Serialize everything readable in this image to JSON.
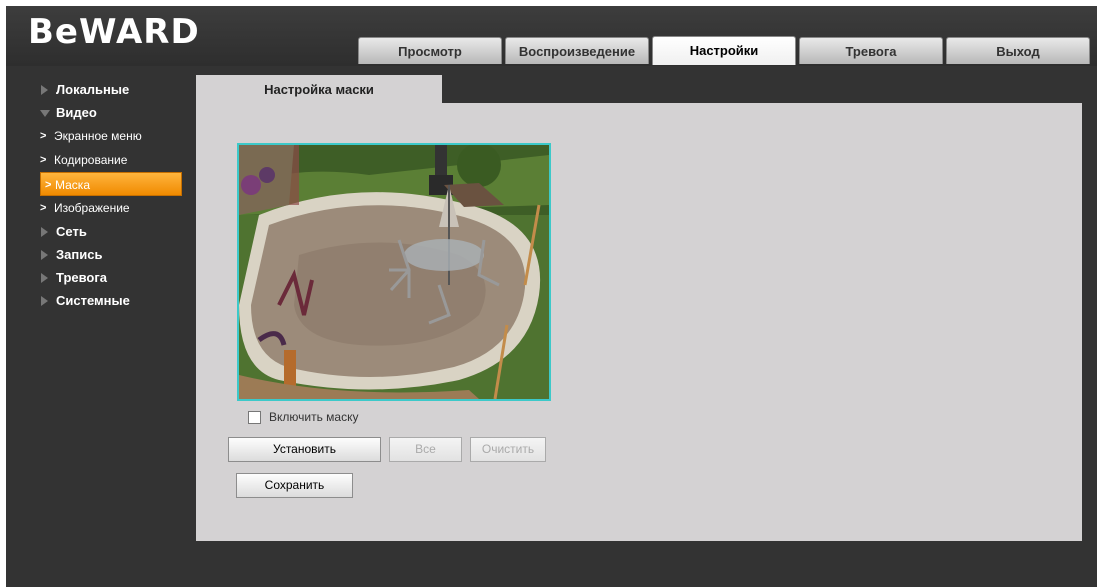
{
  "brand": {
    "logo_text": "BeWARD"
  },
  "tabs": [
    {
      "label": "Просмотр",
      "active": false
    },
    {
      "label": "Воспроизведение",
      "active": false
    },
    {
      "label": "Настройки",
      "active": true
    },
    {
      "label": "Тревога",
      "active": false
    },
    {
      "label": "Выход",
      "active": false
    }
  ],
  "sidebar": {
    "items": [
      {
        "label": "Локальные"
      },
      {
        "label": "Видео"
      },
      {
        "label": "Экранное меню"
      },
      {
        "label": "Кодирование"
      },
      {
        "label": "Маска"
      },
      {
        "label": "Изображение"
      },
      {
        "label": "Сеть"
      },
      {
        "label": "Запись"
      },
      {
        "label": "Тревога"
      },
      {
        "label": "Системные"
      }
    ]
  },
  "content": {
    "section_tab": "Настройка маски",
    "enable_mask_label": "Включить маску",
    "enable_mask_checked": false,
    "buttons": {
      "set": "Установить",
      "all": "Все",
      "clear": "Очистить",
      "save": "Сохранить"
    }
  },
  "colors": {
    "accent_active": "#f39a12",
    "preview_border": "#3cc9c9",
    "panel_bg": "#d4d2d3",
    "frame_bg": "#333333"
  }
}
